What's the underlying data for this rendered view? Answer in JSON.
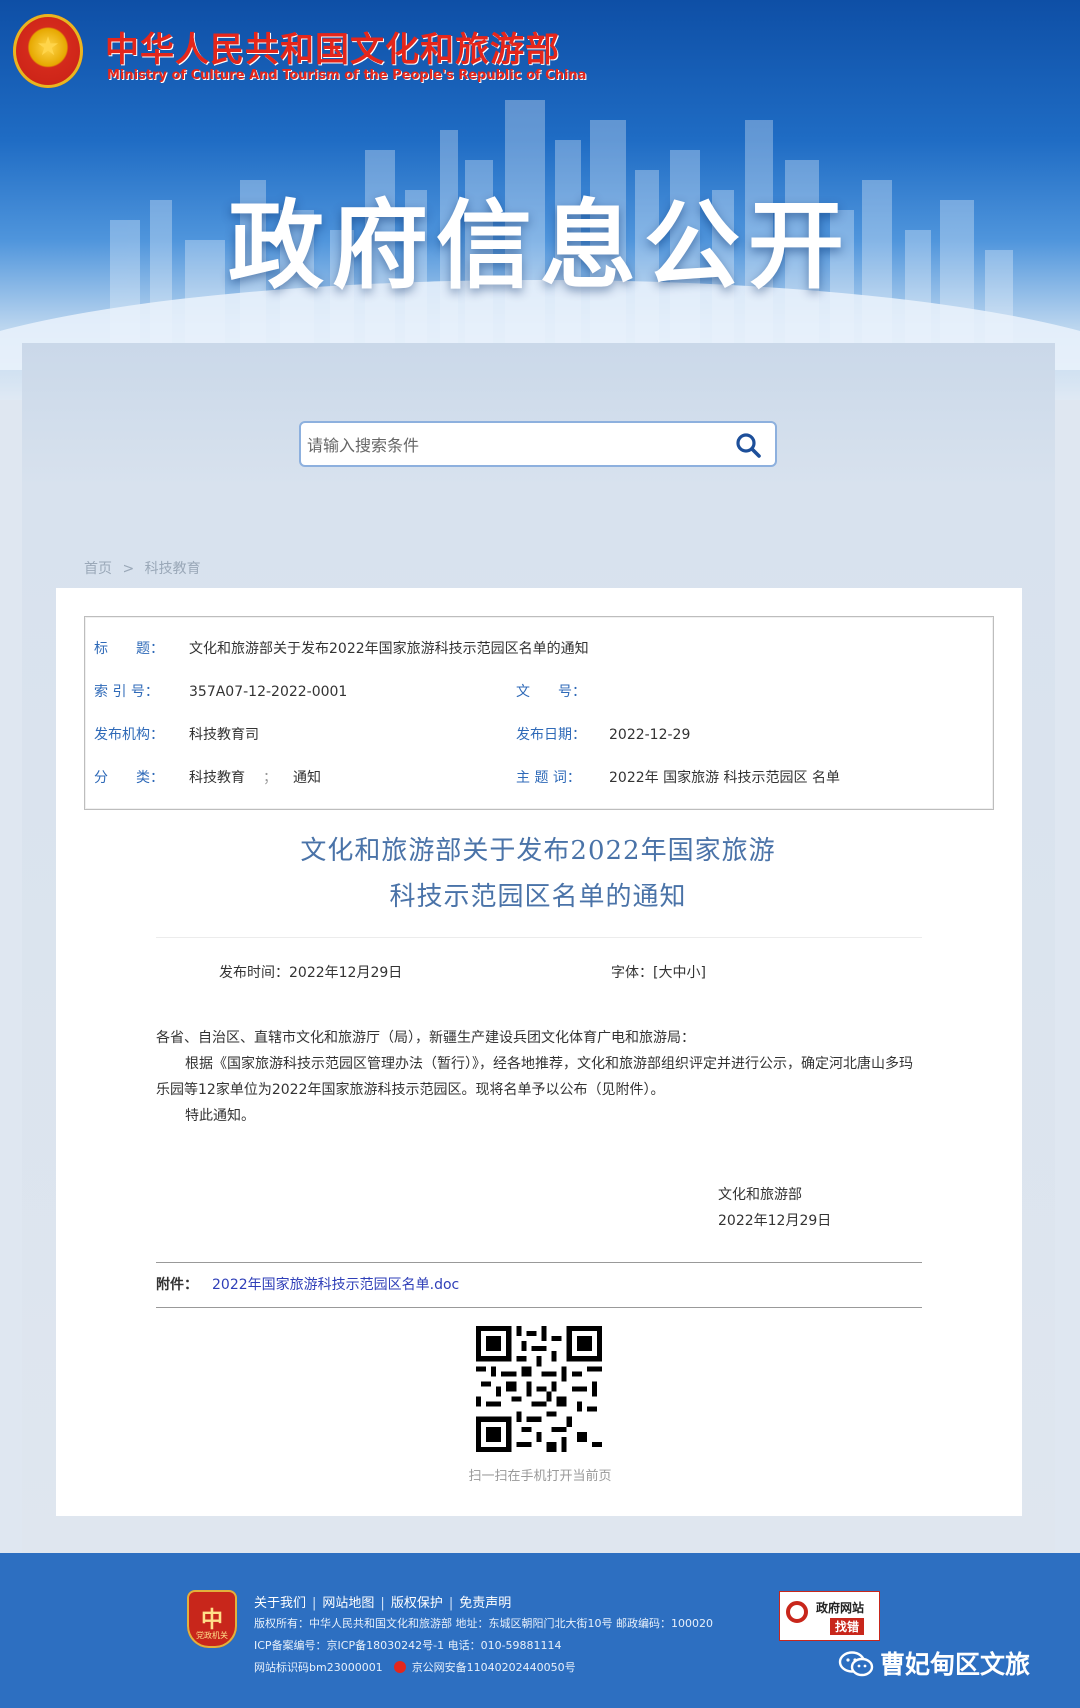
{
  "header": {
    "ministry_cn": "中华人民共和国文化和旅游部",
    "ministry_en": "Ministry of Culture And Tourism of the People's Republic of China",
    "banner_title": "政府信息公开"
  },
  "search": {
    "placeholder": "请输入搜索条件"
  },
  "breadcrumb": {
    "home": "首页",
    "sep": ">",
    "current": "科技教育"
  },
  "meta": {
    "title_label": "标　　题：",
    "title_value": "文化和旅游部关于发布2022年国家旅游科技示范园区名单的通知",
    "index_label": "索 引 号：",
    "index_value": "357A07-12-2022-0001",
    "docno_label": "文　　号：",
    "docno_value": "",
    "org_label": "发布机构：",
    "org_value": "科技教育司",
    "date_label": "发布日期：",
    "date_value": "2022-12-29",
    "cat_label": "分　　类：",
    "cat_value1": "科技教育",
    "cat_sep": "；",
    "cat_value2": "通知",
    "kw_label": "主 题 词：",
    "kw_value": "2022年 国家旅游 科技示范园区 名单"
  },
  "article": {
    "title_line1": "文化和旅游部关于发布2022年国家旅游",
    "title_line2": "科技示范园区名单的通知",
    "pubtime": "发布时间：2022年12月29日",
    "fontsize": "字体：[大中小]",
    "para1": "各省、自治区、直辖市文化和旅游厅（局），新疆生产建设兵团文化体育广电和旅游局：",
    "para2": "根据《国家旅游科技示范园区管理办法（暂行）》，经各地推荐，文化和旅游部组织评定并进行公示，确定河北唐山多玛乐园等12家单位为2022年国家旅游科技示范园区。现将名单予以公布（见附件）。",
    "para3": "特此通知。",
    "signer": "文化和旅游部",
    "sign_date": "2022年12月29日",
    "attach_label": "附件：",
    "attach_link": "2022年国家旅游科技示范园区名单.doc",
    "qr_caption": "扫一扫在手机打开当前页"
  },
  "footer": {
    "badge_char": "中",
    "badge_text": "党政机关",
    "links": [
      "关于我们",
      "网站地图",
      "版权保护",
      "免责声明"
    ],
    "copyright": "版权所有：中华人民共和国文化和旅游部 地址：东城区朝阳门北大街10号 邮政编码：100020",
    "icp": "ICP备案编号：京ICP备18030242号-1      电话：010-59881114",
    "site_id": "网站标识码bm23000001",
    "police": "京公网安备11040202440050号",
    "find_error_1": "政府网站",
    "find_error_2": "找错",
    "wechat_account": "曹妃甸区文旅"
  },
  "colors": {
    "accent": "#2f6ab8",
    "brand_red": "#e4261b",
    "footer_bg": "#2d6fc1"
  }
}
